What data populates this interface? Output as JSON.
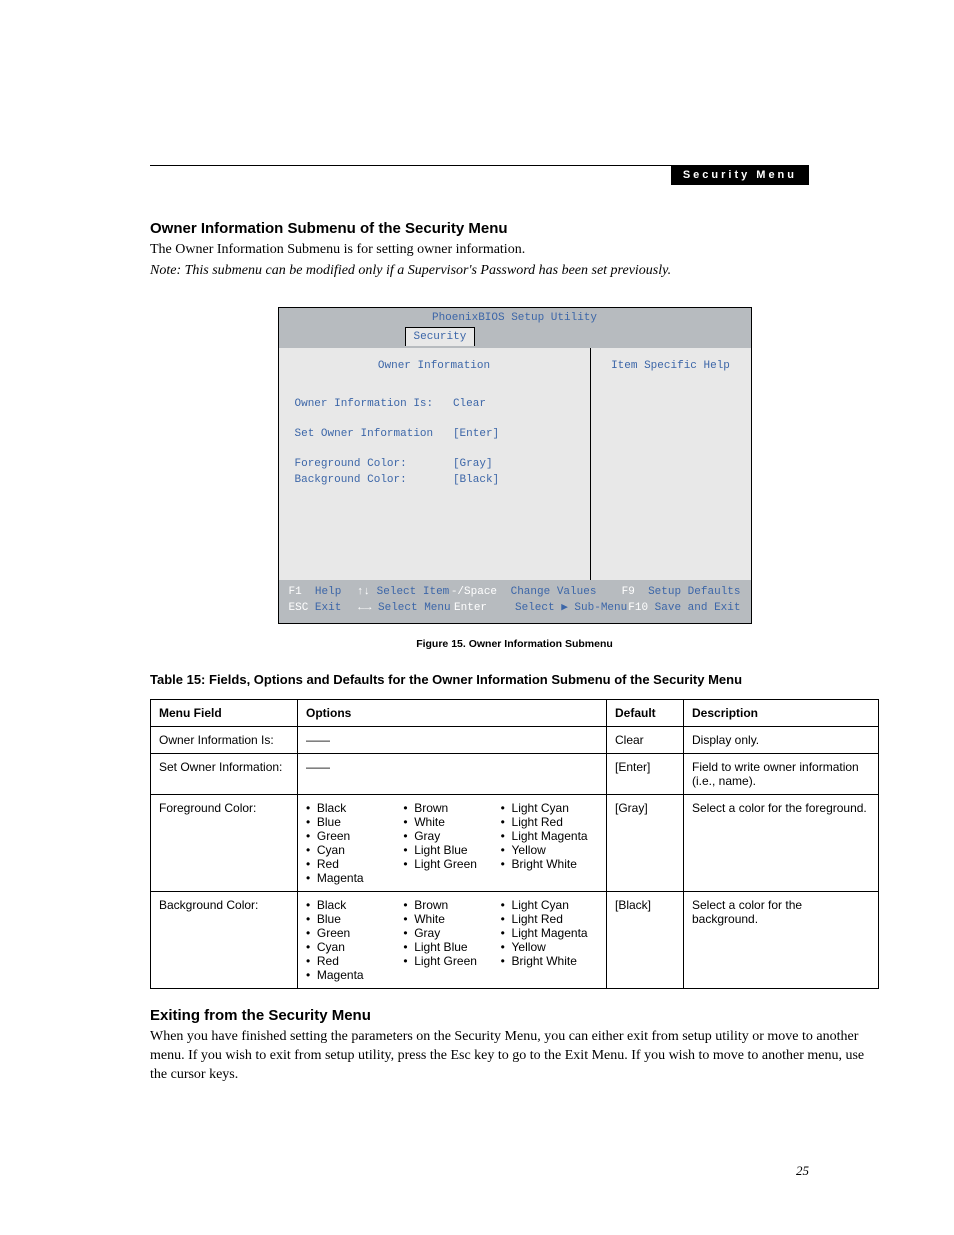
{
  "header": {
    "label": "Security Menu"
  },
  "section1": {
    "heading": "Owner Information Submenu of the Security Menu",
    "p1": "The Owner Information Submenu is for setting owner information.",
    "note": "Note: This submenu can be modified only if a Supervisor's Password has been set previously."
  },
  "bios": {
    "utility_title": "PhoenixBIOS Setup Utility",
    "tab": "Security",
    "panel_title": "Owner Information",
    "help_title": "Item Specific Help",
    "rows": {
      "r1_label": "Owner Information Is:",
      "r1_value": "Clear",
      "r2_label": "Set Owner Information",
      "r2_value": "[Enter]",
      "r3_label": "Foreground Color:",
      "r3_value": "[Gray]",
      "r4_label": "Background Color:",
      "r4_value": "[Black]"
    },
    "footer": {
      "row1": {
        "k1": "F1",
        "t1": "Help",
        "k2": "↑↓",
        "t2": "Select Item",
        "k3": "-/Space",
        "t3": "Change Values",
        "k4": "F9",
        "t4": "Setup Defaults"
      },
      "row2": {
        "k1": "ESC",
        "t1": "Exit",
        "k2": "←→",
        "t2": "Select Menu",
        "k3": "Enter",
        "t3": "Select ▶ Sub-Menu",
        "k4": "F10",
        "t4": "Save and Exit"
      }
    }
  },
  "figure_caption": "Figure 15.  Owner Information Submenu",
  "table_title": "Table 15: Fields, Options and Defaults for the Owner Information Submenu of the Security Menu",
  "table": {
    "headers": {
      "h1": "Menu Field",
      "h2": "Options",
      "h3": "Default",
      "h4": "Description"
    },
    "rows": [
      {
        "field": "Owner Information Is:",
        "options_dash": "——",
        "default": "Clear",
        "description": "Display only."
      },
      {
        "field": "Set Owner Information:",
        "options_dash": "——",
        "default": "[Enter]",
        "description": "Field to write owner information (i.e., name)."
      },
      {
        "field": "Foreground Color:",
        "options_cols": [
          [
            "Black",
            "Blue",
            "Green",
            "Cyan",
            "Red",
            "Magenta"
          ],
          [
            "Brown",
            "White",
            "Gray",
            "Light Blue",
            "Light Green"
          ],
          [
            "Light Cyan",
            "Light Red",
            "Light Magenta",
            "Yellow",
            "Bright White"
          ]
        ],
        "default": "[Gray]",
        "description": "Select a color for the foreground."
      },
      {
        "field": "Background Color:",
        "options_cols": [
          [
            "Black",
            "Blue",
            "Green",
            "Cyan",
            "Red",
            "Magenta"
          ],
          [
            "Brown",
            "White",
            "Gray",
            "Light Blue",
            "Light Green"
          ],
          [
            "Light Cyan",
            "Light Red",
            "Light Magenta",
            "Yellow",
            "Bright White"
          ]
        ],
        "default": "[Black]",
        "description": "Select a color for the background."
      }
    ]
  },
  "section2": {
    "heading": "Exiting from the Security Menu",
    "body": "When you have finished setting the parameters on the Security Menu, you can either exit from setup utility or move to another menu. If you wish to exit from setup utility, press the Esc key to go to the Exit Menu. If you wish to move to another menu, use the cursor keys."
  },
  "page_number": "25"
}
